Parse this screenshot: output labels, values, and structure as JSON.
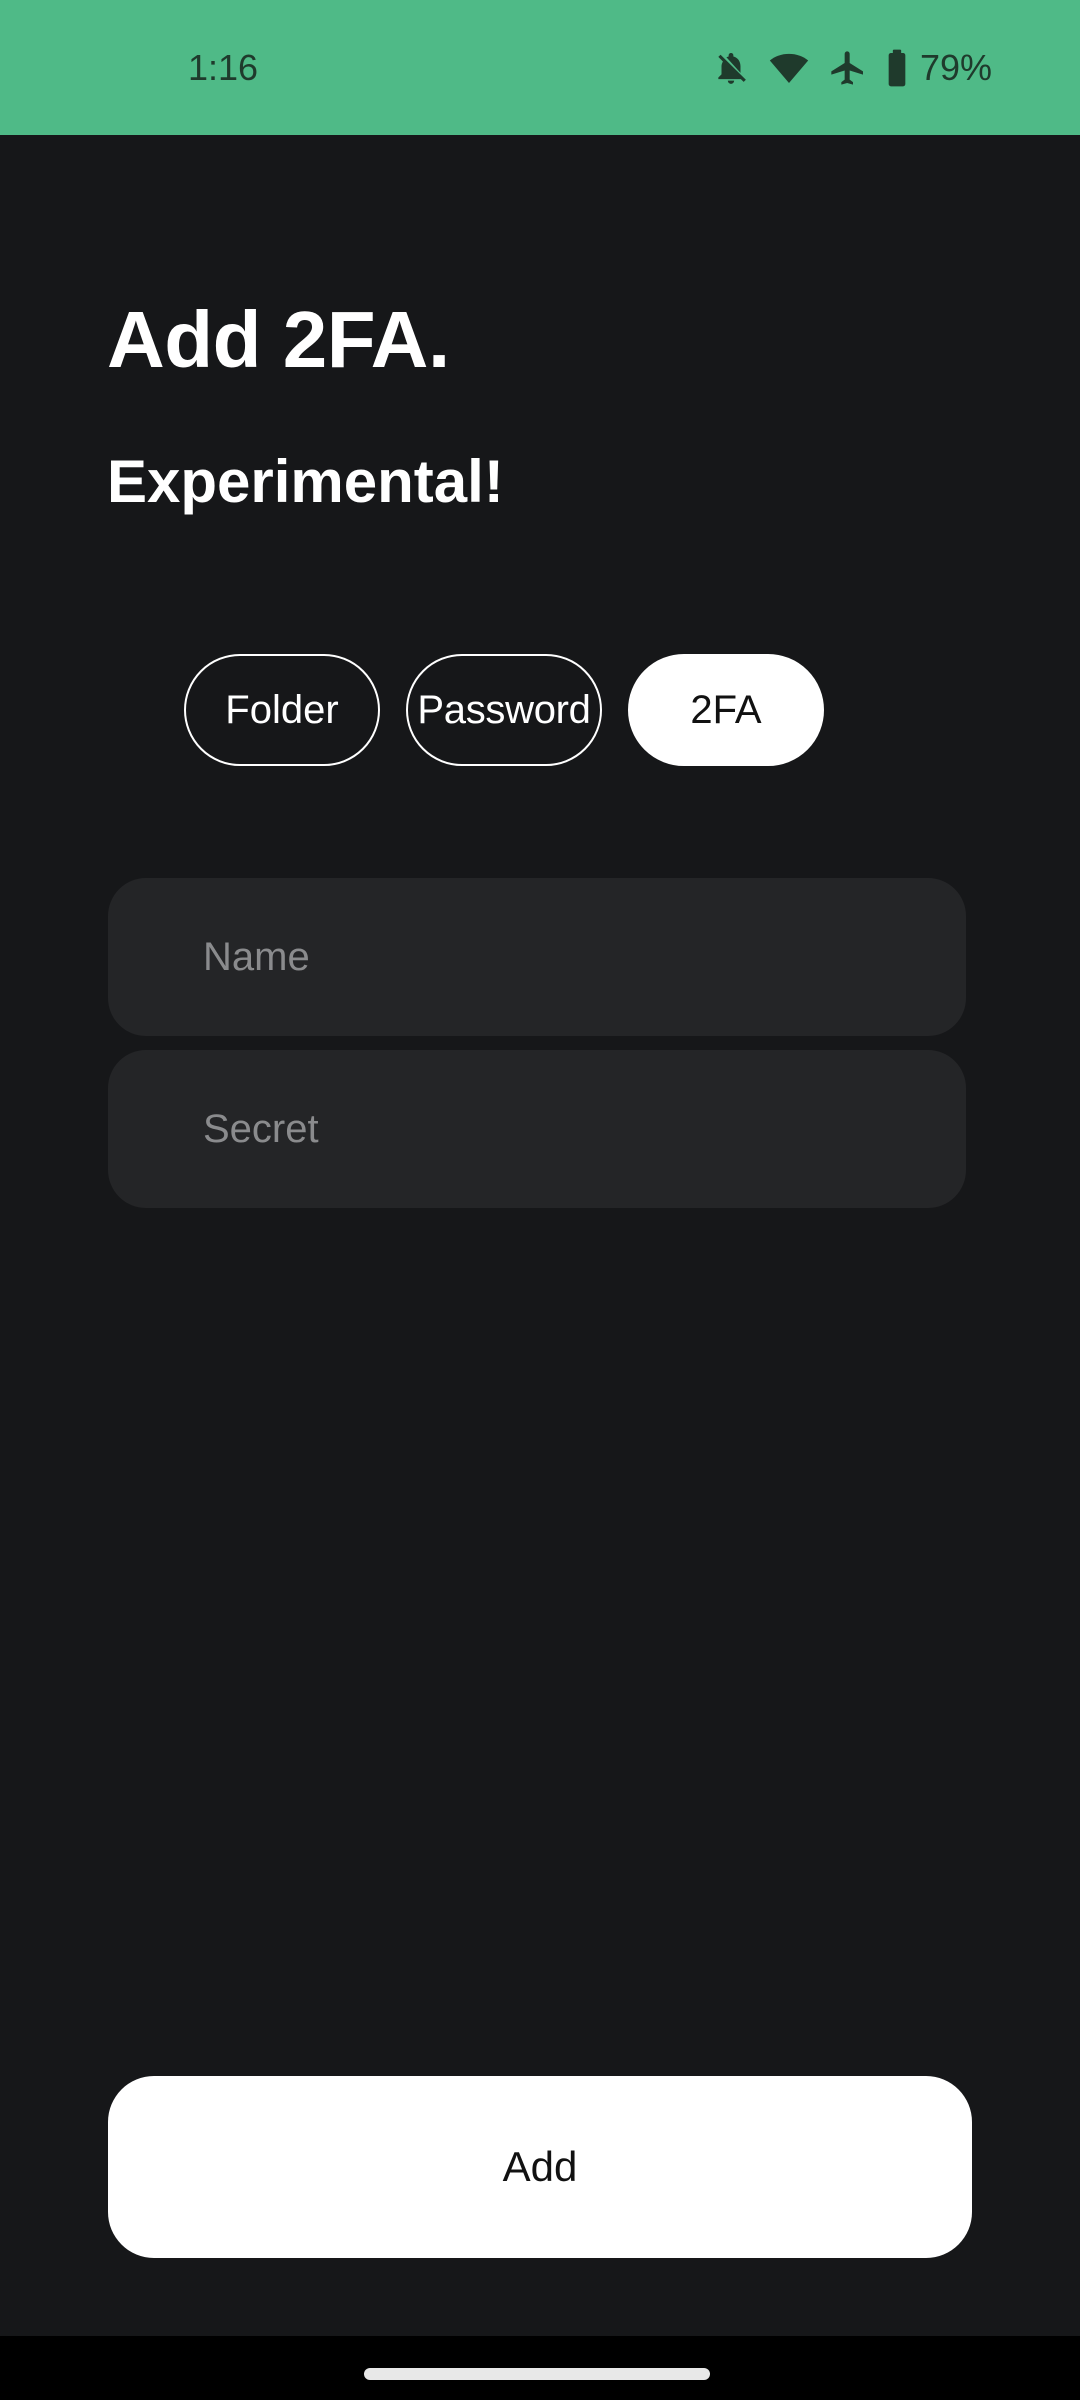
{
  "status_bar": {
    "time": "1:16",
    "battery_percent": "79%",
    "icons": [
      "notifications-off-icon",
      "wifi-icon",
      "airplane-mode-icon",
      "battery-icon"
    ],
    "background_color": "#4fba87"
  },
  "header": {
    "title": "Add 2FA.",
    "subtitle": "Experimental!"
  },
  "type_selector": {
    "options": [
      {
        "label": "Folder",
        "selected": false
      },
      {
        "label": "Password",
        "selected": false
      },
      {
        "label": "2FA",
        "selected": true
      }
    ]
  },
  "form": {
    "name": {
      "value": "",
      "placeholder": "Name"
    },
    "secret": {
      "value": "",
      "placeholder": "Secret"
    }
  },
  "actions": {
    "add_label": "Add"
  },
  "colors": {
    "background": "#161719",
    "field_background": "#242527",
    "accent": "#4fba87"
  }
}
